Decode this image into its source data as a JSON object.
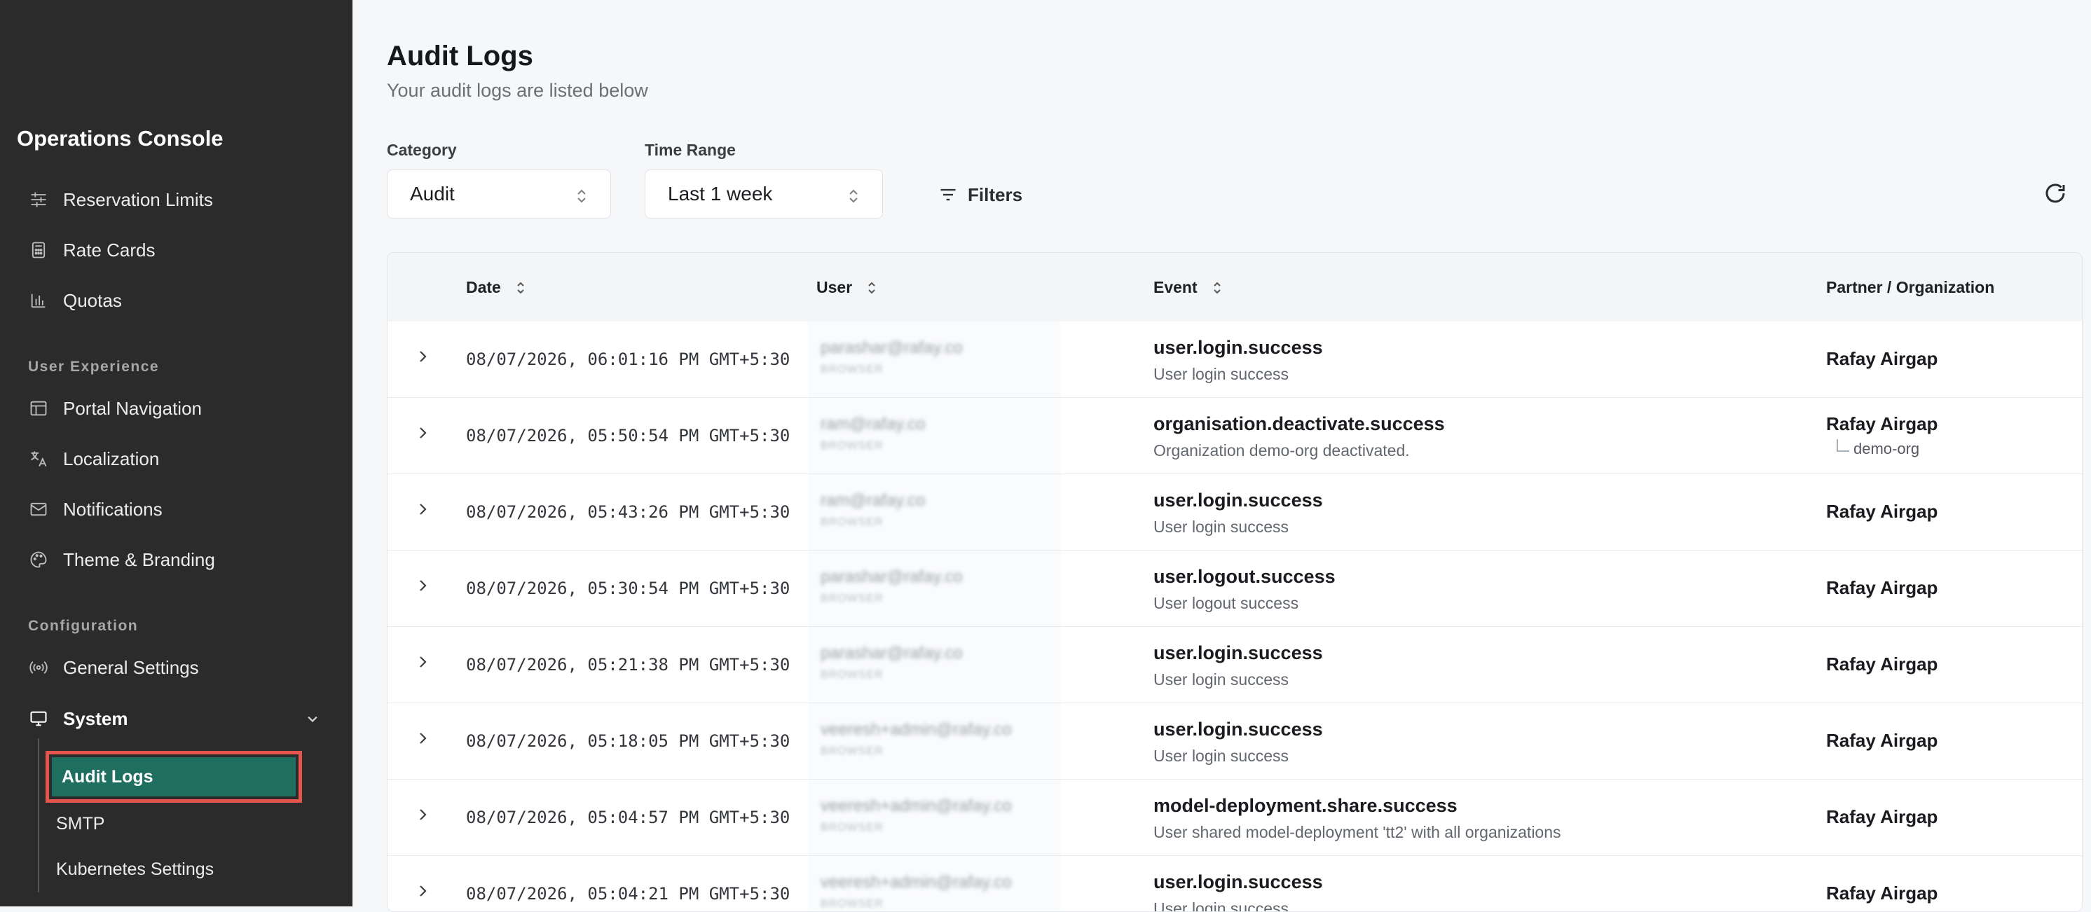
{
  "sidebar": {
    "brand": "Operations Console",
    "items_top": [
      {
        "label": "Reservation Limits",
        "icon": "sliders-icon"
      },
      {
        "label": "Rate Cards",
        "icon": "calculator-icon"
      },
      {
        "label": "Quotas",
        "icon": "bar-chart-icon"
      }
    ],
    "section_user_experience": "User Experience",
    "items_ux": [
      {
        "label": "Portal Navigation",
        "icon": "layout-icon"
      },
      {
        "label": "Localization",
        "icon": "translate-icon"
      },
      {
        "label": "Notifications",
        "icon": "mail-icon"
      },
      {
        "label": "Theme & Branding",
        "icon": "palette-icon"
      }
    ],
    "section_configuration": "Configuration",
    "items_config": [
      {
        "label": "General Settings",
        "icon": "broadcast-icon"
      }
    ],
    "system_label": "System",
    "system_children": [
      {
        "label": "Audit Logs",
        "active": true
      },
      {
        "label": "SMTP"
      },
      {
        "label": "Kubernetes Settings"
      }
    ]
  },
  "page": {
    "title": "Audit Logs",
    "subtitle": "Your audit logs are listed below"
  },
  "filters": {
    "category_label": "Category",
    "category_value": "Audit",
    "time_range_label": "Time Range",
    "time_range_value": "Last 1 week",
    "filters_label": "Filters"
  },
  "table": {
    "headers": {
      "date": "Date",
      "user": "User",
      "event": "Event",
      "org": "Partner / Organization"
    },
    "rows": [
      {
        "date": "08/07/2026, 06:01:16 PM GMT+5:30",
        "user": "parashar@rafay.co",
        "user_sub": "BROWSER",
        "event": "user.login.success",
        "event_desc": "User login success",
        "org": "Rafay Airgap",
        "child_org": ""
      },
      {
        "date": "08/07/2026, 05:50:54 PM GMT+5:30",
        "user": "ram@rafay.co",
        "user_sub": "BROWSER",
        "event": "organisation.deactivate.success",
        "event_desc": "Organization demo-org deactivated.",
        "org": "Rafay Airgap",
        "child_org": "demo-org"
      },
      {
        "date": "08/07/2026, 05:43:26 PM GMT+5:30",
        "user": "ram@rafay.co",
        "user_sub": "BROWSER",
        "event": "user.login.success",
        "event_desc": "User login success",
        "org": "Rafay Airgap",
        "child_org": ""
      },
      {
        "date": "08/07/2026, 05:30:54 PM GMT+5:30",
        "user": "parashar@rafay.co",
        "user_sub": "BROWSER",
        "event": "user.logout.success",
        "event_desc": "User logout success",
        "org": "Rafay Airgap",
        "child_org": ""
      },
      {
        "date": "08/07/2026, 05:21:38 PM GMT+5:30",
        "user": "parashar@rafay.co",
        "user_sub": "BROWSER",
        "event": "user.login.success",
        "event_desc": "User login success",
        "org": "Rafay Airgap",
        "child_org": ""
      },
      {
        "date": "08/07/2026, 05:18:05 PM GMT+5:30",
        "user": "veeresh+admin@rafay.co",
        "user_sub": "BROWSER",
        "event": "user.login.success",
        "event_desc": "User login success",
        "org": "Rafay Airgap",
        "child_org": ""
      },
      {
        "date": "08/07/2026, 05:04:57 PM GMT+5:30",
        "user": "veeresh+admin@rafay.co",
        "user_sub": "BROWSER",
        "event": "model-deployment.share.success",
        "event_desc": "User shared model-deployment 'tt2' with all organizations",
        "org": "Rafay Airgap",
        "child_org": ""
      },
      {
        "date": "08/07/2026, 05:04:21 PM GMT+5:30",
        "user": "veeresh+admin@rafay.co",
        "user_sub": "BROWSER",
        "event": "user.login.success",
        "event_desc": "User login success",
        "org": "Rafay Airgap",
        "child_org": ""
      }
    ]
  }
}
